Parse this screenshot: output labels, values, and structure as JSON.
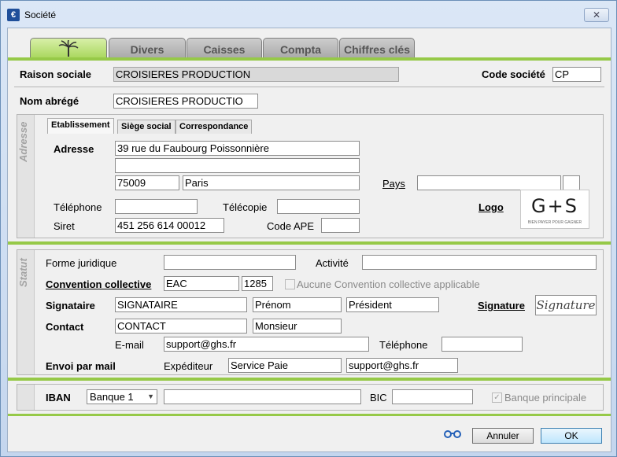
{
  "window": {
    "title": "Société",
    "close_glyph": "✕"
  },
  "tabs": [
    {
      "label": "",
      "icon": "palm-tree-icon",
      "active": true
    },
    {
      "label": "Divers"
    },
    {
      "label": "Caisses"
    },
    {
      "label": "Compta"
    },
    {
      "label": "Chiffres clés"
    }
  ],
  "header": {
    "raison_sociale_label": "Raison sociale",
    "raison_sociale_value": "CROISIERES PRODUCTION",
    "code_societe_label": "Code société",
    "code_societe_value": "CP",
    "nom_abrege_label": "Nom abrégé",
    "nom_abrege_value": "CROISIERES PRODUCTIO"
  },
  "adresse": {
    "section_label": "Adresse",
    "subtabs": [
      "Etablissement",
      "Siège social",
      "Correspondance"
    ],
    "adresse_label": "Adresse",
    "line1": "39 rue du Faubourg Poissonnière",
    "line2": "",
    "code_postal": "75009",
    "ville": "Paris",
    "pays_label": "Pays",
    "pays_value": "",
    "pays_code": "",
    "telephone_label": "Téléphone",
    "telephone_value": "",
    "telecopie_label": "Télécopie",
    "telecopie_value": "",
    "logo_label": "Logo",
    "logo_text": "G+S",
    "logo_tagline": "BIEN PAYER POUR GAGNER",
    "siret_label": "Siret",
    "siret_value": "451 256 614 00012",
    "code_ape_label": "Code APE",
    "code_ape_value": ""
  },
  "statut": {
    "section_label": "Statut",
    "forme_juridique_label": "Forme juridique",
    "forme_juridique_value": "",
    "activite_label": "Activité",
    "activite_value": "",
    "convention_label": "Convention collective",
    "convention_code": "EAC",
    "convention_num": "1285",
    "aucune_convention_label": "Aucune Convention collective applicable",
    "signataire_label": "Signataire",
    "signataire_nom": "SIGNATAIRE",
    "signataire_prenom": "Prénom",
    "signataire_fonction": "Président",
    "signature_label": "Signature",
    "signature_image_text": "Signature",
    "contact_label": "Contact",
    "contact_nom": "CONTACT",
    "contact_civilite": "Monsieur",
    "email_label": "E-mail",
    "email_value": "support@ghs.fr",
    "contact_telephone_label": "Téléphone",
    "contact_telephone_value": "",
    "envoi_label": "Envoi par mail",
    "expediteur_label": "Expéditeur",
    "expediteur_nom": "Service Paie",
    "expediteur_email": "support@ghs.fr"
  },
  "banque": {
    "iban_label": "IBAN",
    "banque_select": "Banque 1",
    "iban_value": "",
    "bic_label": "BIC",
    "bic_value": "",
    "banque_principale_label": "Banque principale"
  },
  "footer": {
    "glasses_icon": "glasses-icon",
    "annuler_label": "Annuler",
    "ok_label": "OK"
  },
  "colors": {
    "accent_green": "#96c948",
    "tab_active": "#a7d65a",
    "window_frame": "#c4d6ee"
  }
}
